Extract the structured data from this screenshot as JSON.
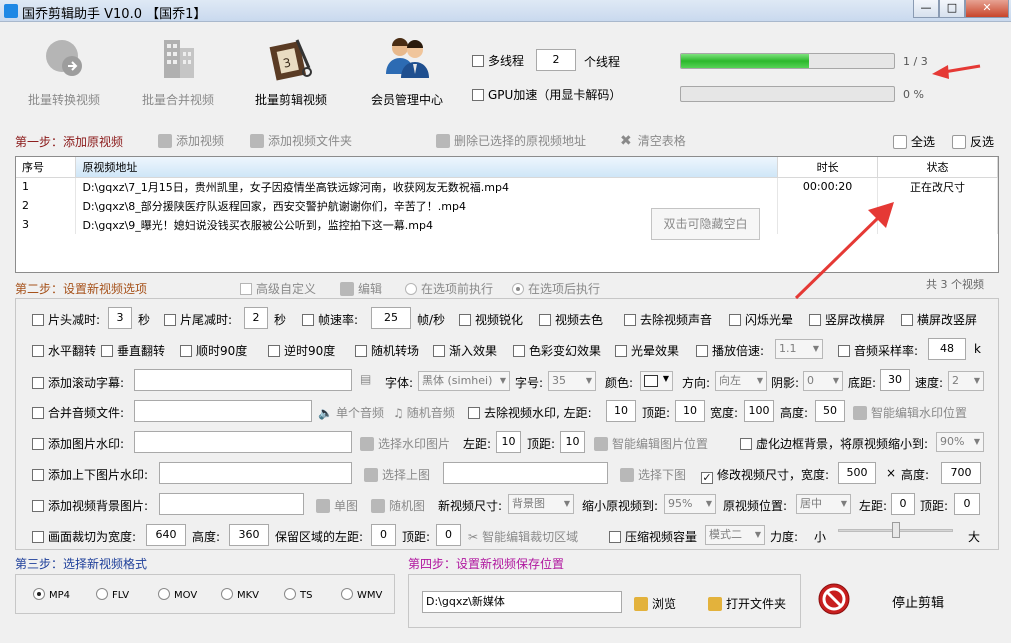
{
  "window": {
    "title": "国乔剪辑助手 V10.0 【国乔1】",
    "min": "—",
    "max": "□",
    "close": "✕"
  },
  "toolbar": [
    {
      "label": "批量转换视频",
      "icon": "convert-icon",
      "enabled": false
    },
    {
      "label": "批量合并视频",
      "icon": "merge-icon",
      "enabled": false
    },
    {
      "label": "批量剪辑视频",
      "icon": "film-edit-icon",
      "enabled": true
    },
    {
      "label": "会员管理中心",
      "icon": "members-icon",
      "enabled": true
    }
  ],
  "threads": {
    "label": "多线程",
    "value": "2",
    "unit": "个线程"
  },
  "gpu": {
    "label": "GPU加速（用显卡解码）"
  },
  "progress": [
    {
      "text": "1 / 3",
      "fraction": 0.6
    },
    {
      "text": "0 %",
      "fraction": 0
    }
  ],
  "step1": {
    "title": "第一步：添加原视频",
    "add_video": "添加视频",
    "add_folder": "添加视频文件夹",
    "delete": "删除已选择的原视频地址",
    "clear": "清空表格",
    "select_all": "全选",
    "invert": "反选"
  },
  "table": {
    "headers": [
      "序号",
      "原视频地址",
      "时长",
      "状态"
    ],
    "rows": [
      [
        "1",
        "D:\\gqxz\\7_1月15日，贵州凯里，女子因疫情坐高铁远嫁河南，收获网友无数祝福.mp4",
        "00:00:20",
        "正在改尺寸"
      ],
      [
        "2",
        "D:\\gqxz\\8_部分援陕医疗队返程回家，西安交警护航谢谢你们，辛苦了！.mp4",
        "",
        ""
      ],
      [
        "3",
        "D:\\gqxz\\9_曝光！媳妇说没钱买衣服被公公听到，监控拍下这一幕.mp4",
        "",
        ""
      ]
    ],
    "tooltip": "双击可隐藏空白"
  },
  "step2": {
    "title": "第二步：设置新视频选项",
    "advanced": "高级自定义",
    "edit": "编辑",
    "before": "在选项前执行",
    "after": "在选项后执行",
    "count": "共 3 个视频"
  },
  "opts": {
    "head_cut": "片头减时:",
    "head_val": "3",
    "sec": "秒",
    "tail_cut": "片尾减时:",
    "tail_val": "2",
    "fps": "帧速率:",
    "fps_val": "25",
    "fps_unit": "帧/秒",
    "sharpen": "视频锐化",
    "decolor": "视频去色",
    "mute": "去除视频声音",
    "flash": "闪烁光晕",
    "v2h": "竖屏改横屏",
    "h2v": "横屏改竖屏",
    "hflip": "水平翻转",
    "vflip": "垂直翻转",
    "cw90": "顺时90度",
    "ccw90": "逆时90度",
    "rand_trans": "随机转场",
    "fadein": "渐入效果",
    "colorfx": "色彩变幻效果",
    "halo": "光晕效果",
    "speed": "播放倍速:",
    "speed_val": "1.1",
    "samplerate": "音频采样率:",
    "sr_val": "48",
    "k": "k",
    "scroll": "添加滚动字幕:",
    "font": "字体:",
    "font_val": "黑体 (simhei)",
    "size": "字号:",
    "size_val": "35",
    "color": "颜色:",
    "direction": "方向:",
    "dir_val": "向左",
    "shadow": "阴影:",
    "shadow_val": "0",
    "bottom": "底距:",
    "bottom_val": "30",
    "spd": "速度:",
    "spd_val": "2",
    "merge_audio": "合并音频文件:",
    "single_audio": "单个音频",
    "rand_audio": "随机音频",
    "remove_wm": "去除视频水印, 左距:",
    "wm_left": "10",
    "top": "顶距:",
    "wm_top": "10",
    "width": "宽度:",
    "wm_w": "100",
    "height": "高度:",
    "wm_h": "50",
    "smart_wm": "智能编辑水印位置",
    "add_img_wm": "添加图片水印:",
    "choose_wm": "选择水印图片",
    "left": "左距:",
    "img_left": "10",
    "img_top": "10",
    "smart_img": "智能编辑图片位置",
    "blur_border": "虚化边框背景，将原视频缩小到:",
    "blur_val": "90%",
    "add_tb": "添加上下图片水印:",
    "choose_top": "选择上图",
    "choose_bottom": "选择下图",
    "resize": "修改视频尺寸，宽度:",
    "resize_w": "500",
    "x": "×",
    "height2": "高度:",
    "resize_h": "700",
    "add_bg": "添加视频背景图片:",
    "single_img": "单图",
    "rand_img": "随机图",
    "new_size": "新视频尺寸:",
    "new_size_val": "背景图",
    "shrink": "缩小原视频到:",
    "shrink_val": "95%",
    "orig_pos": "原视频位置:",
    "pos_val": "居中",
    "bg_left": "0",
    "bg_top": "0",
    "crop": "画面裁切为宽度:",
    "crop_w": "640",
    "crop_h": "360",
    "keep_left": "保留区域的左距:",
    "keep_left_val": "0",
    "keep_top_val": "0",
    "smart_crop": "智能编辑裁切区域",
    "compress": "压缩视频容量",
    "mode_val": "模式二",
    "strength": "力度:",
    "small": "小",
    "big": "大",
    "strength_level": 0.5
  },
  "step3": {
    "title": "第三步：选择新视频格式",
    "formats": [
      "MP4",
      "FLV",
      "MOV",
      "MKV",
      "TS",
      "WMV"
    ]
  },
  "step4": {
    "title": "第四步：设置新视频保存位置",
    "path": "D:\\gqxz\\新媒体",
    "browse": "浏览",
    "open_folder": "打开文件夹",
    "stop": "停止剪辑"
  }
}
